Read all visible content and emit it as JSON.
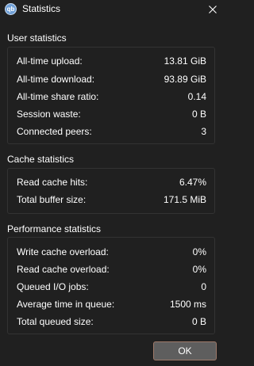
{
  "window": {
    "title": "Statistics",
    "icon": "qbittorrent-app-icon",
    "icon_text": "qb"
  },
  "user_statistics": {
    "title": "User statistics",
    "rows": [
      {
        "label": "All-time upload:",
        "value": "13.81 GiB"
      },
      {
        "label": "All-time download:",
        "value": "93.89 GiB"
      },
      {
        "label": "All-time share ratio:",
        "value": "0.14"
      },
      {
        "label": "Session waste:",
        "value": "0 B"
      },
      {
        "label": "Connected peers:",
        "value": "3"
      }
    ]
  },
  "cache_statistics": {
    "title": "Cache statistics",
    "rows": [
      {
        "label": "Read cache hits:",
        "value": "6.47%"
      },
      {
        "label": "Total buffer size:",
        "value": "171.5 MiB"
      }
    ]
  },
  "performance_statistics": {
    "title": "Performance statistics",
    "rows": [
      {
        "label": "Write cache overload:",
        "value": "0%"
      },
      {
        "label": "Read cache overload:",
        "value": "0%"
      },
      {
        "label": "Queued I/O jobs:",
        "value": "0"
      },
      {
        "label": "Average time in queue:",
        "value": "1500 ms"
      },
      {
        "label": "Total queued size:",
        "value": "0 B"
      }
    ]
  },
  "buttons": {
    "ok_label": "OK"
  },
  "colors": {
    "background": "#202020",
    "text": "#ffffff",
    "group_border": "#333333",
    "ok_border": "#9e7a6a",
    "ok_fill": "#5e5e5e"
  }
}
